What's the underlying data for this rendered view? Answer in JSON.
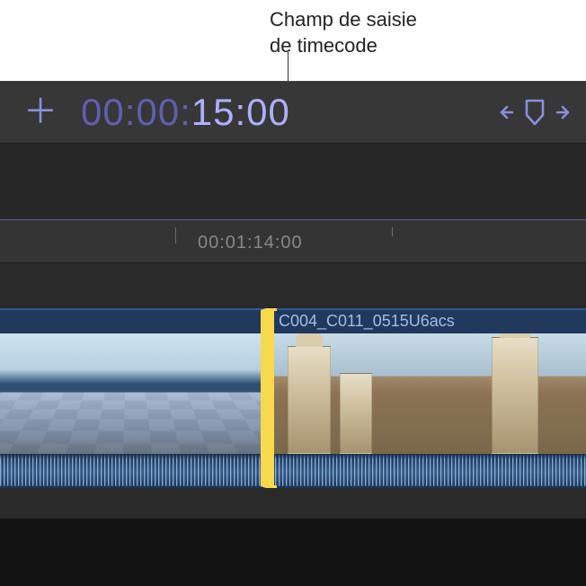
{
  "callout": {
    "line1": "Champ de saisie",
    "line2": "de timecode"
  },
  "toolbar": {
    "add_icon": "plus-icon",
    "timecode_dim": "00:00:",
    "timecode_bright": "15:00",
    "skim_icon": "skim-playhead-icon"
  },
  "ruler": {
    "timecode": "00:01:14:00"
  },
  "timeline": {
    "clips": [
      {
        "name": ""
      },
      {
        "name": "C004_C011_0515U6acs"
      }
    ]
  },
  "colors": {
    "accent": "#8a8fdd",
    "edit_point": "#f7d94c",
    "clip_bg": "#2e5072"
  }
}
